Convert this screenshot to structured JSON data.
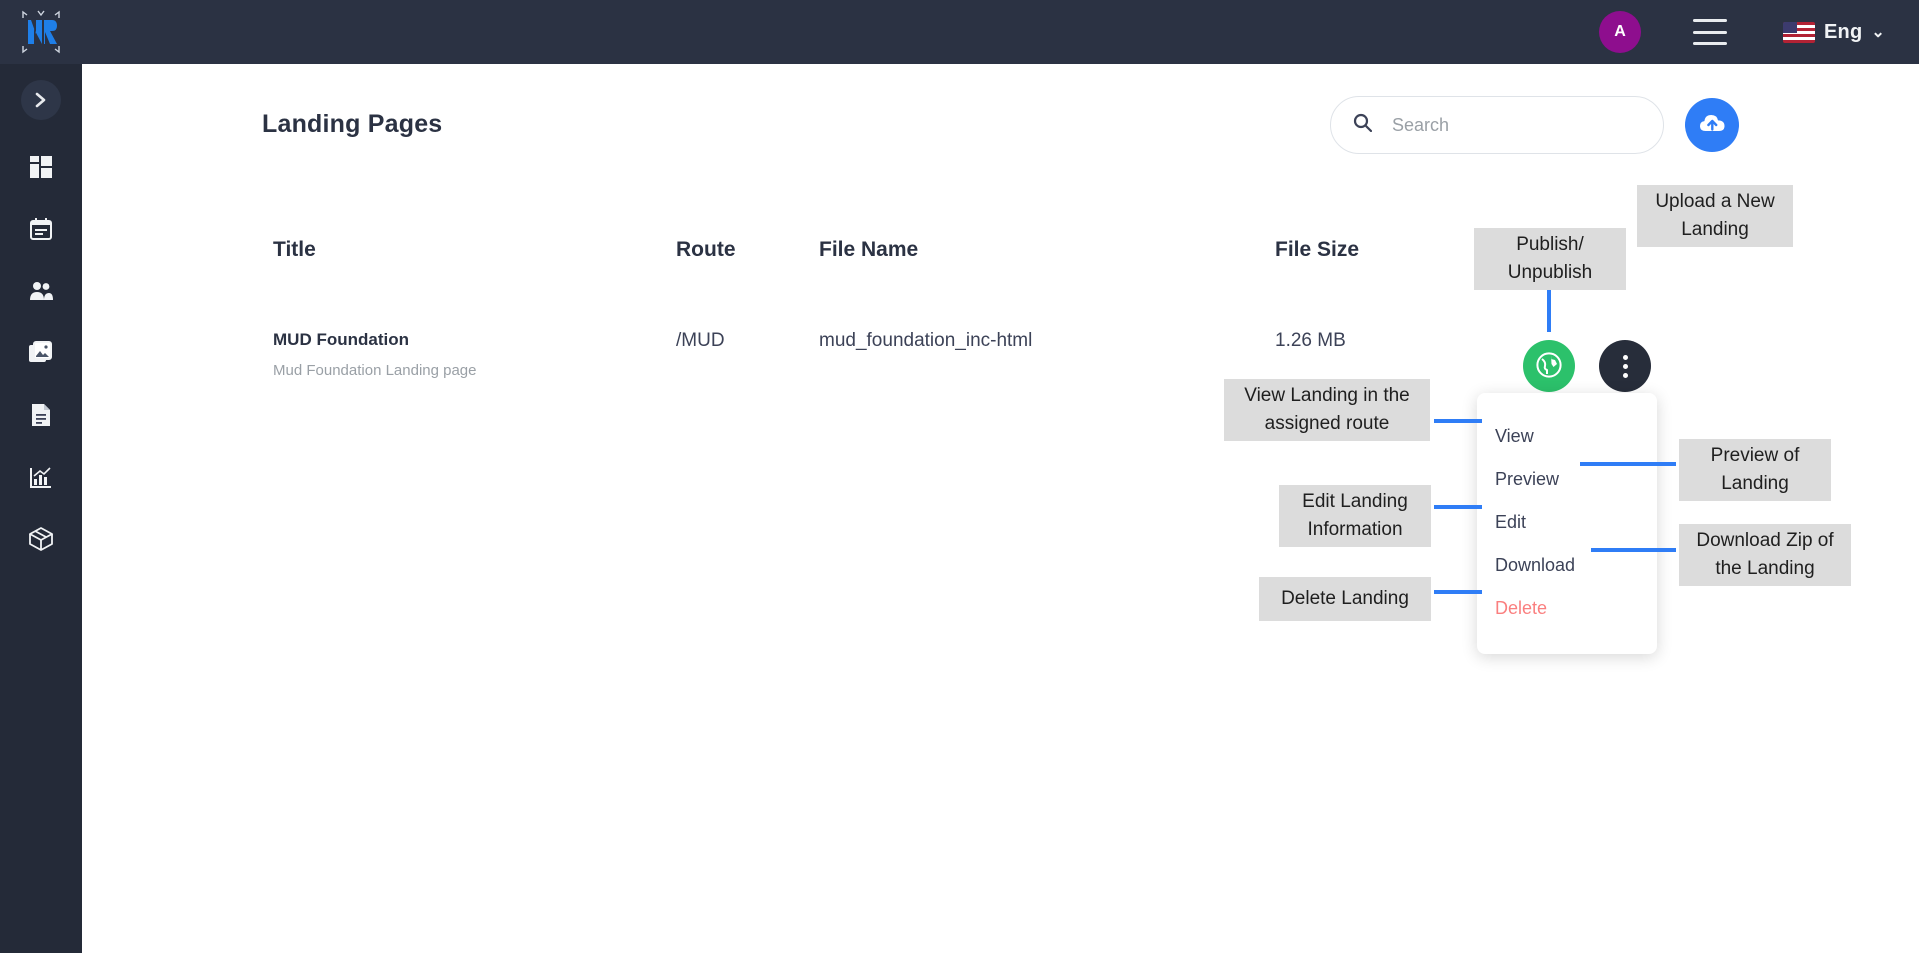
{
  "sidebar": {
    "logo_name": "nr-logo",
    "collapse_label": "›",
    "items": [
      {
        "icon": "dashboard-grid-icon",
        "name": "sidebar-item-dashboard"
      },
      {
        "icon": "calendar-icon",
        "name": "sidebar-item-calendar"
      },
      {
        "icon": "users-icon",
        "name": "sidebar-item-users"
      },
      {
        "icon": "gallery-icon",
        "name": "sidebar-item-gallery"
      },
      {
        "icon": "document-icon",
        "name": "sidebar-item-documents"
      },
      {
        "icon": "chart-icon",
        "name": "sidebar-item-analytics"
      },
      {
        "icon": "box-icon",
        "name": "sidebar-item-packages"
      }
    ]
  },
  "topbar": {
    "avatar_initial": "A",
    "menu_icon": "hamburger-icon",
    "flag_icon": "us-flag-icon",
    "language": "Eng",
    "chevron": "⌄"
  },
  "page": {
    "title": "Landing Pages"
  },
  "search": {
    "icon": "search-icon",
    "placeholder": "Search",
    "value": ""
  },
  "upload": {
    "icon": "cloud-upload-icon",
    "label": "Upload"
  },
  "table": {
    "columns": [
      "Title",
      "Route",
      "File Name",
      "File Size"
    ],
    "rows": [
      {
        "title": "MUD Foundation",
        "subtitle": "Mud Foundation Landing page",
        "route": "/MUD",
        "file_name": "mud_foundation_inc-html",
        "file_size": "1.26 MB",
        "publish_icon": "globe-icon",
        "more_icon": "kebab-menu-icon"
      }
    ]
  },
  "menu": {
    "items": [
      {
        "label": "View",
        "danger": false
      },
      {
        "label": "Preview",
        "danger": false
      },
      {
        "label": "Edit",
        "danger": false
      },
      {
        "label": "Download",
        "danger": false
      },
      {
        "label": "Delete",
        "danger": true
      }
    ]
  },
  "callouts": {
    "upload": "Upload a New Landing",
    "publish": "Publish/ Unpublish",
    "view": "View Landing in the assigned route",
    "edit": "Edit Landing Information",
    "delete": "Delete Landing",
    "preview": "Preview of Landing",
    "download": "Download Zip of the Landing"
  },
  "colors": {
    "sidebar": "#242a38",
    "topbar": "#2b3243",
    "accent_blue": "#2f7df6",
    "publish_green": "#2cc16b",
    "kebab_dark": "#272d3a",
    "avatar_purple": "#8e0e8e",
    "danger_red": "#fa7f7f",
    "callout_bg": "#dcdcdc"
  }
}
